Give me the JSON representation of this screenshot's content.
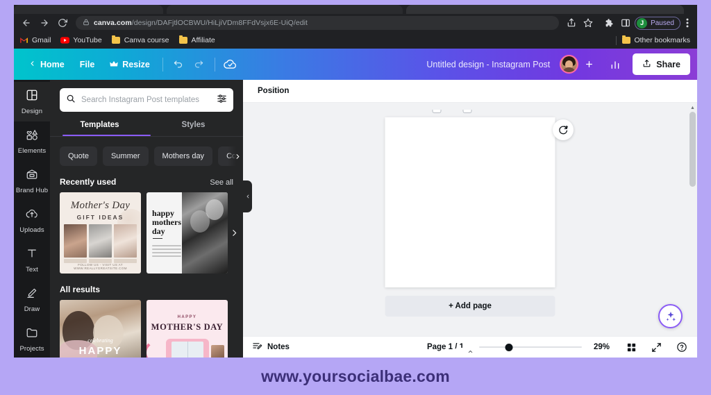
{
  "browser": {
    "url_domain": "canva.com",
    "url_path": "/design/DAFjtlOCBWU/HiLjiVDm8FFdVsjx6E-UiQ/edit",
    "back_icon": "back-arrow-icon",
    "forward_icon": "forward-arrow-icon",
    "reload_icon": "reload-icon",
    "lock_icon": "lock-icon",
    "share_icon": "share-icon",
    "bookmark_icon": "star-icon",
    "extensions_icon": "puzzle-icon",
    "sidepanel_icon": "side-panel-icon",
    "menu_icon": "three-dot-menu-icon",
    "profile": {
      "initial": "J",
      "status": "Paused"
    },
    "bookmarks": [
      {
        "label": "Gmail",
        "icon": "gmail-icon"
      },
      {
        "label": "YouTube",
        "icon": "youtube-icon"
      },
      {
        "label": "Canva course",
        "icon": "folder-icon"
      },
      {
        "label": "Affiliate",
        "icon": "folder-icon"
      }
    ],
    "other_bookmarks": {
      "label": "Other bookmarks",
      "icon": "folder-icon"
    }
  },
  "header": {
    "home_label": "Home",
    "file_label": "File",
    "resize_label": "Resize",
    "resize_icon": "crown-icon",
    "back_icon": "chevron-left-icon",
    "undo_icon": "undo-icon",
    "redo_icon": "redo-icon",
    "cloud_icon": "cloud-saved-icon",
    "doc_title": "Untitled design - Instagram Post",
    "avatar_icon": "avatar",
    "add_collaborator_icon": "plus-icon",
    "insights_icon": "bar-chart-icon",
    "share_label": "Share",
    "share_icon": "upload-icon"
  },
  "rail": {
    "items": [
      {
        "label": "Design",
        "icon": "design-icon",
        "active": true
      },
      {
        "label": "Elements",
        "icon": "elements-icon",
        "active": false
      },
      {
        "label": "Brand Hub",
        "icon": "brand-hub-icon",
        "active": false
      },
      {
        "label": "Uploads",
        "icon": "uploads-cloud-icon",
        "active": false
      },
      {
        "label": "Text",
        "icon": "text-icon",
        "active": false
      },
      {
        "label": "Draw",
        "icon": "draw-pencil-icon",
        "active": false
      },
      {
        "label": "Projects",
        "icon": "projects-folder-icon",
        "active": false
      }
    ]
  },
  "panel": {
    "search": {
      "placeholder": "Search Instagram Post templates",
      "value": "",
      "search_icon": "search-icon",
      "filter_icon": "filter-sliders-icon"
    },
    "tabs": [
      {
        "label": "Templates",
        "active": true
      },
      {
        "label": "Styles",
        "active": false
      }
    ],
    "chips": [
      "Quote",
      "Summer",
      "Mothers day",
      "Collage"
    ],
    "chips_next_icon": "chevron-right-icon",
    "recently_used": {
      "title": "Recently used",
      "see_all": "See all",
      "next_icon": "chevron-right-icon",
      "items": [
        {
          "title": "Mother's Day",
          "subtitle": "GIFT IDEAS",
          "footer": "FOLLOW US - VISIT US AT WWW.REALLYGREATSITE.COM"
        },
        {
          "title": "happy\nmothers\nday"
        }
      ]
    },
    "all_results": {
      "title": "All results",
      "items": [
        {
          "script": "celebrating",
          "big": "HAPPY"
        },
        {
          "top": "HAPPY",
          "big": "MOTHER'S DAY"
        }
      ]
    },
    "collapse_icon": "chevron-left-icon"
  },
  "editor": {
    "toolbar": {
      "position_label": "Position"
    },
    "page_refresh_icon": "animate-rotate-icon",
    "add_page_label": "+ Add page",
    "magic_icon": "magic-sparkle-icon",
    "scroll_notch_icon": "chevron-up-icon"
  },
  "statusbar": {
    "notes_label": "Notes",
    "notes_icon": "notes-pencil-icon",
    "page_count": "Page 1 / 1",
    "zoom_percent": "29%",
    "grid_icon": "grid-view-icon",
    "fullscreen_icon": "fullscreen-icon",
    "help_icon": "help-question-icon"
  },
  "watermark": {
    "text": "www.yoursocialbae.com"
  },
  "colors": {
    "watermark_bg": "#b5a6f5",
    "watermark_fg": "#3c2f78",
    "accent_purple": "#8b5cf6",
    "canva_teal": "#00c4cc",
    "canva_purple": "#8b3dd6",
    "avatar_ring": "#ff6ba6",
    "profile_green": "#1e8e3e"
  }
}
